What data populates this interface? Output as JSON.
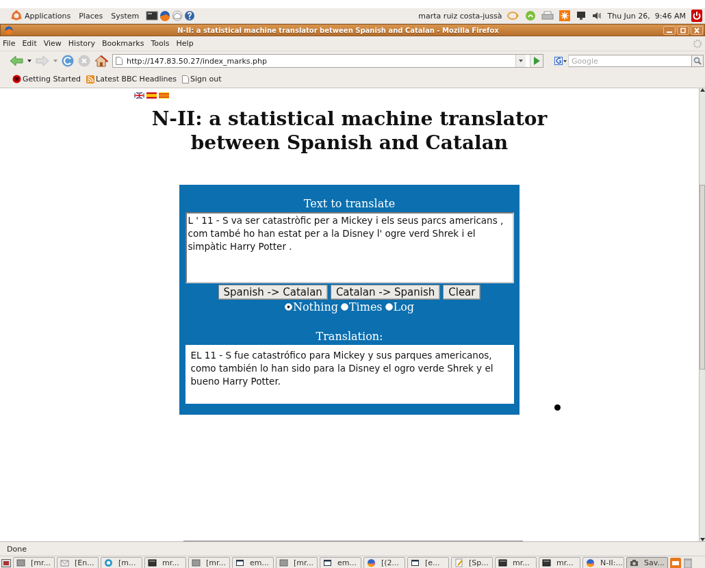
{
  "top_panel": {
    "menus": [
      "Applications",
      "Places",
      "System"
    ],
    "user": "marta ruiz costa-jussà",
    "clock": "Thu Jun 26,  9:46 AM"
  },
  "window": {
    "title": "N-II: a statistical machine translator between Spanish and Catalan - Mozilla Firefox"
  },
  "menu_bar": [
    "File",
    "Edit",
    "View",
    "History",
    "Bookmarks",
    "Tools",
    "Help"
  ],
  "address_bar": {
    "value": "http://147.83.50.27/index_marks.php"
  },
  "search": {
    "placeholder": "Google"
  },
  "bookmarks": [
    "Getting Started",
    "Latest BBC Headlines",
    "Sign out"
  ],
  "page": {
    "heading": "N-II: a statistical machine translator between Spanish and Catalan",
    "source_label": "Text to translate",
    "source_text": "L ' 11 - S va ser catastròfic per a Mickey i els seus parcs americans , com també ho han estat per a la Disney l' ogre verd Shrek i el simpàtic Harry Potter .",
    "buttons": [
      "Spanish -> Catalan",
      "Catalan -> Spanish",
      "Clear"
    ],
    "options": [
      {
        "label": "Nothing",
        "selected": true
      },
      {
        "label": "Times",
        "selected": false
      },
      {
        "label": "Log",
        "selected": false
      }
    ],
    "translation_label": "Translation:",
    "translation": "EL 11 - S fue catastrófico para Mickey y sus parques americanos, como también lo han sido para la Disney el ogro verde Shrek y el bueno Harry Potter."
  },
  "status_bar": "Done",
  "taskbar": [
    {
      "label": "[mr...",
      "kind": "window",
      "selected": false
    },
    {
      "label": "[En...",
      "kind": "mail",
      "selected": false
    },
    {
      "label": "[m...",
      "kind": "chat",
      "selected": false
    },
    {
      "label": "mr...",
      "kind": "terminal",
      "selected": false
    },
    {
      "label": "[mr...",
      "kind": "window",
      "selected": false
    },
    {
      "label": "em...",
      "kind": "frame",
      "selected": false
    },
    {
      "label": "[mr...",
      "kind": "window",
      "selected": false
    },
    {
      "label": "em...",
      "kind": "frame",
      "selected": false
    },
    {
      "label": "[(2...",
      "kind": "browser",
      "selected": false
    },
    {
      "label": "[e...",
      "kind": "frame",
      "selected": false
    },
    {
      "label": "[Sp...",
      "kind": "note",
      "selected": false
    },
    {
      "label": "mr...",
      "kind": "terminal",
      "selected": false
    },
    {
      "label": "mr...",
      "kind": "terminal",
      "selected": false
    },
    {
      "label": "N-II:...",
      "kind": "browser",
      "selected": false
    },
    {
      "label": "Sav...",
      "kind": "camera",
      "selected": true
    }
  ]
}
